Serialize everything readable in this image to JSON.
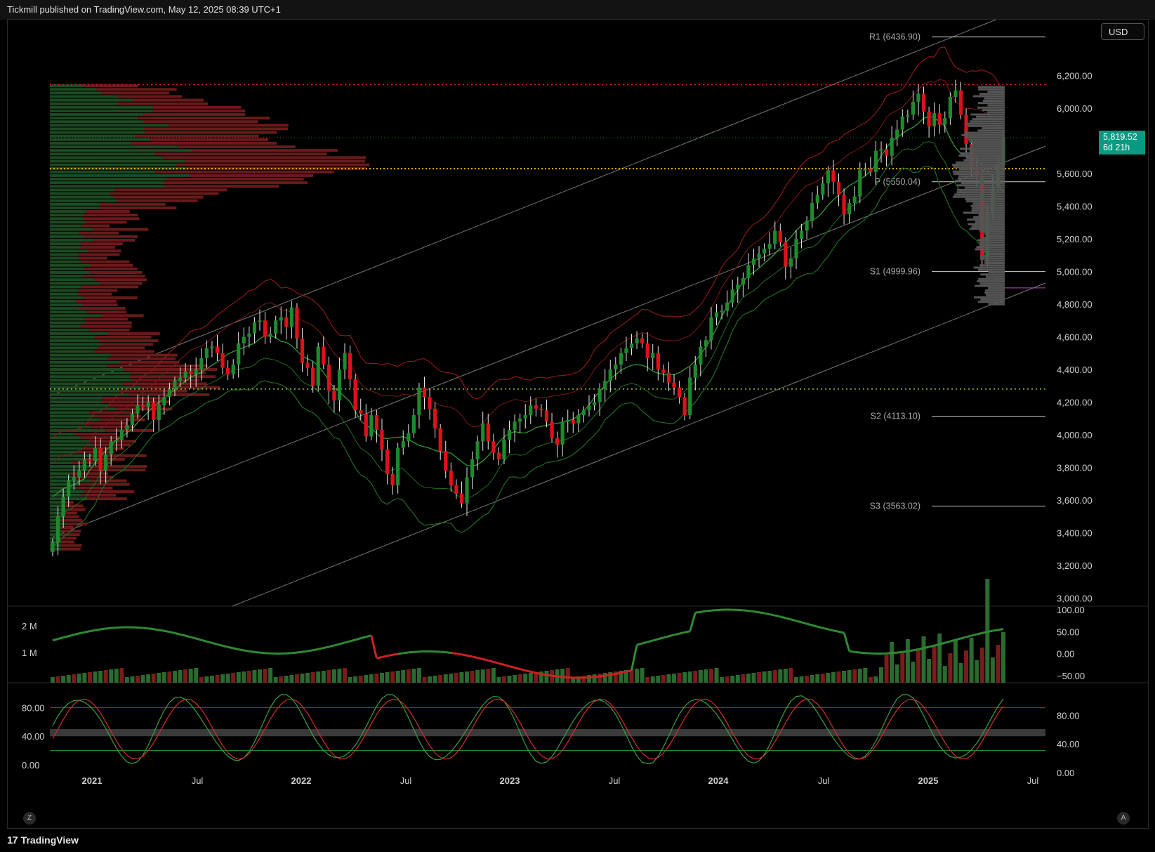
{
  "header": {
    "publish_text": "Tickmill published on TradingView.com, May 12, 2025 08:39 UTC+1"
  },
  "footer": {
    "brand": "TradingView"
  },
  "currency_button": "USD",
  "last_price": {
    "price": "5,819.52",
    "countdown": "6d 21h"
  },
  "buttons": {
    "z": "Z",
    "a": "A"
  },
  "colors": {
    "up": "#1f8a2c",
    "down": "#e0101a",
    "red_band": "#8a1a1a",
    "green_band": "#1e6e24",
    "pivot": "#e0e0e0",
    "yellow_poc": "#e8b400",
    "green_dotted": "#9acd32"
  },
  "chart_data": [
    {
      "type": "candlestick",
      "title": "",
      "y_axis": {
        "ticks": [
          "6,200.00",
          "6,000.00",
          "5,600.00",
          "5,400.00",
          "5,200.00",
          "5,000.00",
          "4,800.00",
          "4,600.00",
          "4,400.00",
          "4,200.00",
          "4,000.00",
          "3,800.00",
          "3,600.00",
          "3,400.00",
          "3,200.00",
          "3,000.00"
        ],
        "range": [
          2950,
          6500
        ],
        "log": false
      },
      "x_axis": {
        "ticks": [
          "2021",
          "Jul",
          "2022",
          "Jul",
          "2023",
          "Jul",
          "2024",
          "Jul",
          "2025",
          "Jul"
        ]
      },
      "pivots": [
        {
          "label": "R1 (6436.90)",
          "value": 6436.9
        },
        {
          "label": "P (5550.04)",
          "value": 5550.04
        },
        {
          "label": "S1 (4999.96)",
          "value": 4999.96
        },
        {
          "label": "S2 (4113.10)",
          "value": 4113.1
        },
        {
          "label": "S3 (3563.02)",
          "value": 3563.02
        }
      ],
      "horizontal_levels": {
        "red_dotted": 6145,
        "yellow_dotted": 5630,
        "green_dotted": 4280,
        "last_price": 5819.52
      },
      "weekly_closes_approx": [
        3340,
        3500,
        3620,
        3720,
        3740,
        3780,
        3850,
        3840,
        3920,
        3780,
        3880,
        3960,
        3970,
        4030,
        4060,
        4130,
        4180,
        4170,
        4200,
        4090,
        4180,
        4230,
        4280,
        4330,
        4350,
        4390,
        4370,
        4400,
        4470,
        4530,
        4540,
        4500,
        4410,
        4370,
        4430,
        4560,
        4600,
        4620,
        4690,
        4700,
        4600,
        4620,
        4700,
        4720,
        4660,
        4780,
        4590,
        4440,
        4410,
        4300,
        4540,
        4430,
        4270,
        4210,
        4400,
        4500,
        4340,
        4150,
        4130,
        3990,
        4120,
        4030,
        3910,
        3760,
        3690,
        3920,
        3960,
        4010,
        4120,
        4290,
        4230,
        4160,
        4040,
        3900,
        3780,
        3690,
        3640,
        3580,
        3740,
        3850,
        3960,
        4070,
        3960,
        3890,
        3850,
        3970,
        4030,
        4080,
        4100,
        4120,
        4180,
        4160,
        4150,
        4080,
        3980,
        3940,
        4080,
        4090,
        4070,
        4120,
        4150,
        4180,
        4200,
        4280,
        4330,
        4400,
        4430,
        4500,
        4530,
        4560,
        4590,
        4560,
        4470,
        4500,
        4400,
        4380,
        4320,
        4290,
        4230,
        4120,
        4350,
        4430,
        4540,
        4580,
        4720,
        4750,
        4760,
        4810,
        4890,
        4920,
        4960,
        5040,
        5080,
        5110,
        5140,
        5170,
        5250,
        5180,
        5030,
        5080,
        5200,
        5250,
        5310,
        5420,
        5470,
        5540,
        5620,
        5550,
        5470,
        5350,
        5420,
        5460,
        5620,
        5630,
        5610,
        5740,
        5750,
        5710,
        5820,
        5870,
        5950,
        5960,
        6040,
        6090,
        5980,
        5890,
        5970,
        5900,
        5940,
        6070,
        6110,
        5960,
        5780,
        5640,
        5580,
        5070,
        5360,
        5520,
        5650,
        5820
      ]
    },
    {
      "type": "bar",
      "title": "",
      "y_axis_left": {
        "ticks": [
          "2 M",
          "1 M"
        ]
      },
      "y_axis_right": {
        "ticks": [
          "100.00",
          "50.00",
          "0.00",
          "−50.00"
        ],
        "range": [
          -60,
          100
        ]
      }
    },
    {
      "type": "line",
      "title": "",
      "y_axis": {
        "ticks": [
          "80.00",
          "40.00",
          "0.00"
        ],
        "range": [
          0,
          100
        ]
      },
      "levels": {
        "upper": 80,
        "lower": 20,
        "band": [
          40,
          50
        ]
      }
    }
  ]
}
